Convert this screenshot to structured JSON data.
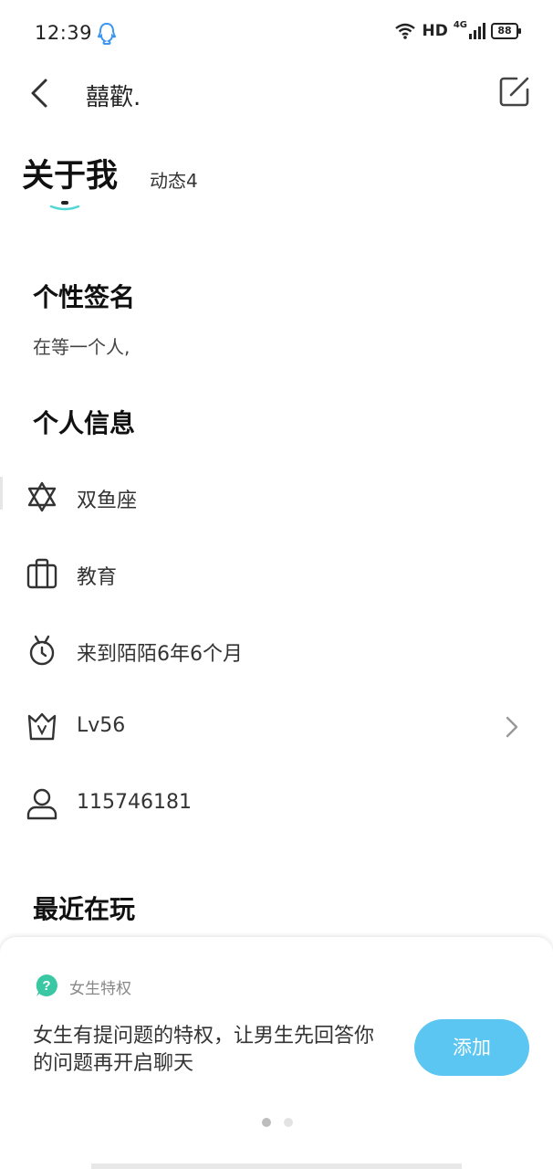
{
  "status_bar": {
    "time": "12:39",
    "network": "HD",
    "network_type": "4G",
    "battery": "88",
    "icons": [
      "qq-icon",
      "wifi-icon",
      "signal-icon",
      "battery-icon"
    ]
  },
  "header": {
    "title": "囍歡.",
    "back_icon": "chevron-left-icon",
    "edit_icon": "edit-icon"
  },
  "tabs": [
    {
      "label": "关于我",
      "active": true
    },
    {
      "label": "动态4",
      "active": false
    }
  ],
  "signature_section": {
    "title": "个性签名",
    "text": "在等一个人,"
  },
  "info_section": {
    "title": "个人信息",
    "rows": [
      {
        "icon": "star-of-david-icon",
        "text": "双鱼座"
      },
      {
        "icon": "briefcase-icon",
        "text": "教育"
      },
      {
        "icon": "stopwatch-icon",
        "text": "来到陌陌6年6个月"
      },
      {
        "icon": "crown-icon",
        "text": "Lv56",
        "has_arrow": true
      },
      {
        "icon": "user-icon",
        "text": "115746181"
      }
    ]
  },
  "recent_section": {
    "title": "最近在玩"
  },
  "privilege_sheet": {
    "label": "女生特权",
    "description": "女生有提问题的特权，让男生先回答你的问题再开启聊天",
    "button": "添加",
    "page_count": 2,
    "active_page": 1
  },
  "colors": {
    "accent": "#5cc6f2",
    "badge": "#39c8a3",
    "tab_indicator": "#4fd8d8"
  }
}
